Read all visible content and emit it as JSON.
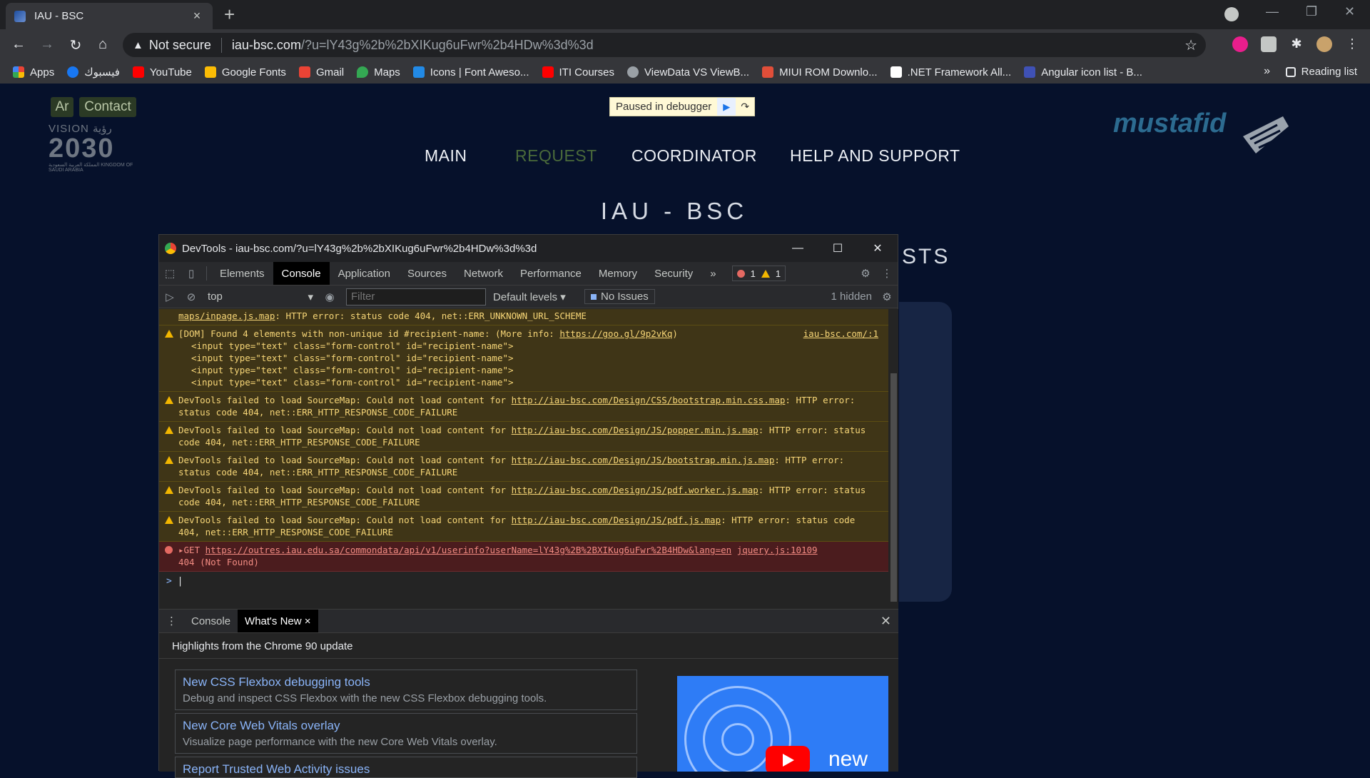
{
  "browser": {
    "tab_title": "IAU - BSC",
    "new_tab": "+",
    "omnibox": {
      "security": "Not secure",
      "host": "iau-bsc.com",
      "path": "/?u=lY43g%2b%2bXIKug6uFwr%2b4HDw%3d%3d"
    },
    "bookmarks": [
      {
        "label": "Apps",
        "color": "#ea4335"
      },
      {
        "label": "فيسبوك",
        "color": "#1877f2"
      },
      {
        "label": "YouTube",
        "color": "#ff0000"
      },
      {
        "label": "Google Fonts",
        "color": "#fbbc05"
      },
      {
        "label": "Gmail",
        "color": "#ea4335"
      },
      {
        "label": "Maps",
        "color": "#34a853"
      },
      {
        "label": "Icons | Font Aweso...",
        "color": "#228ae6"
      },
      {
        "label": "ITI Courses",
        "color": "#ff0000"
      },
      {
        "label": "ViewData VS ViewB...",
        "color": "#9aa0a6"
      },
      {
        "label": "MIUI ROM Downlo...",
        "color": "#e04e39"
      },
      {
        "label": ".NET Framework All...",
        "color": "#ffffff"
      },
      {
        "label": "Angular icon list - B...",
        "color": "#3f51b5"
      }
    ],
    "bookmarks_more": "»",
    "reading_list": "Reading list"
  },
  "site": {
    "lang_ar": "Ar",
    "contact": "Contact",
    "vision_top": "VISION رؤية",
    "vision_year": "2030",
    "vision_sub": "المملكة العربية السعودية KINGDOM OF SAUDI ARABIA",
    "paused_label": "Paused in debugger",
    "nav": [
      "MAIN",
      "REQUEST",
      "COORDINATOR",
      "HELP AND SUPPORT"
    ],
    "active_nav": "REQUEST",
    "title": "IAU - BSC",
    "partial_heading": "STS",
    "mustafid": "mustafid"
  },
  "devtools": {
    "window_title": "DevTools - iau-bsc.com/?u=lY43g%2b%2bXIKug6uFwr%2b4HDw%3d%3d",
    "tabs": [
      "Elements",
      "Console",
      "Application",
      "Sources",
      "Network",
      "Performance",
      "Memory",
      "Security"
    ],
    "active_tab": "Console",
    "more_tabs": "»",
    "error_count": "1",
    "warning_count": "1",
    "context": "top",
    "filter_placeholder": "Filter",
    "levels": "Default levels",
    "issues": "No Issues",
    "hidden": "1 hidden",
    "messages": {
      "m0": {
        "link": "maps/inpage.js.map",
        "text": ": HTTP error: status code 404, net::ERR_UNKNOWN_URL_SCHEME"
      },
      "m1": {
        "text": "[DOM] Found 4 elements with non-unique id #recipient-name: (More info: ",
        "link": "https://goo.gl/9p2vKq",
        "text_end": ")",
        "source": "iau-bsc.com/:1",
        "code": [
          "<input type=\"text\" class=\"form-control\" id=\"recipient-name\">",
          "<input type=\"text\" class=\"form-control\" id=\"recipient-name\">",
          "<input type=\"text\" class=\"form-control\" id=\"recipient-name\">",
          "<input type=\"text\" class=\"form-control\" id=\"recipient-name\">"
        ]
      },
      "m2": {
        "text": "DevTools failed to load SourceMap: Could not load content for ",
        "link": "http://iau-bsc.com/Design/CSS/bootstrap.min.css.map",
        "tail": ": HTTP error: status code 404, net::ERR_HTTP_RESPONSE_CODE_FAILURE"
      },
      "m3": {
        "text": "DevTools failed to load SourceMap: Could not load content for ",
        "link": "http://iau-bsc.com/Design/JS/popper.min.js.map",
        "tail": ": HTTP error: status code 404, net::ERR_HTTP_RESPONSE_CODE_FAILURE"
      },
      "m4": {
        "text": "DevTools failed to load SourceMap: Could not load content for ",
        "link": "http://iau-bsc.com/Design/JS/bootstrap.min.js.map",
        "tail": ": HTTP error: status code 404, net::ERR_HTTP_RESPONSE_CODE_FAILURE"
      },
      "m5": {
        "text": "DevTools failed to load SourceMap: Could not load content for ",
        "link": "http://iau-bsc.com/Design/JS/pdf.worker.js.map",
        "tail": ": HTTP error: status code 404, net::ERR_HTTP_RESPONSE_CODE_FAILURE"
      },
      "m6": {
        "text": "DevTools failed to load SourceMap: Could not load content for ",
        "link": "http://iau-bsc.com/Design/JS/pdf.js.map",
        "tail": ": HTTP error: status code 404, net::ERR_HTTP_RESPONSE_CODE_FAILURE"
      },
      "m7": {
        "method": "GET ",
        "link": "https://outres.iau.edu.sa/commondata/api/v1/userinfo?userName=lY43g%2B%2BXIKug6uFwr%2B4HDw&lang=en",
        "source": "jquery.js:10109",
        "status": "404 (Not Found)"
      }
    },
    "prompt": ">",
    "drawer": {
      "tabs": [
        "Console",
        "What's New"
      ],
      "active": "What's New",
      "header": "Highlights from the Chrome 90 update",
      "cards": [
        {
          "title": "New CSS Flexbox debugging tools",
          "desc": "Debug and inspect CSS Flexbox with the new CSS Flexbox debugging tools."
        },
        {
          "title": "New Core Web Vitals overlay",
          "desc": "Visualize page performance with the new Core Web Vitals overlay."
        },
        {
          "title": "Report Trusted Web Activity issues",
          "desc": ""
        }
      ],
      "video_word": "new"
    }
  },
  "colors": {
    "page_bg": "#06112b",
    "active_nav": "#4a6a3a",
    "warn_bg": "#3f3517",
    "err_bg": "#4b1c1e",
    "link_blue": "#8ab4f8"
  }
}
